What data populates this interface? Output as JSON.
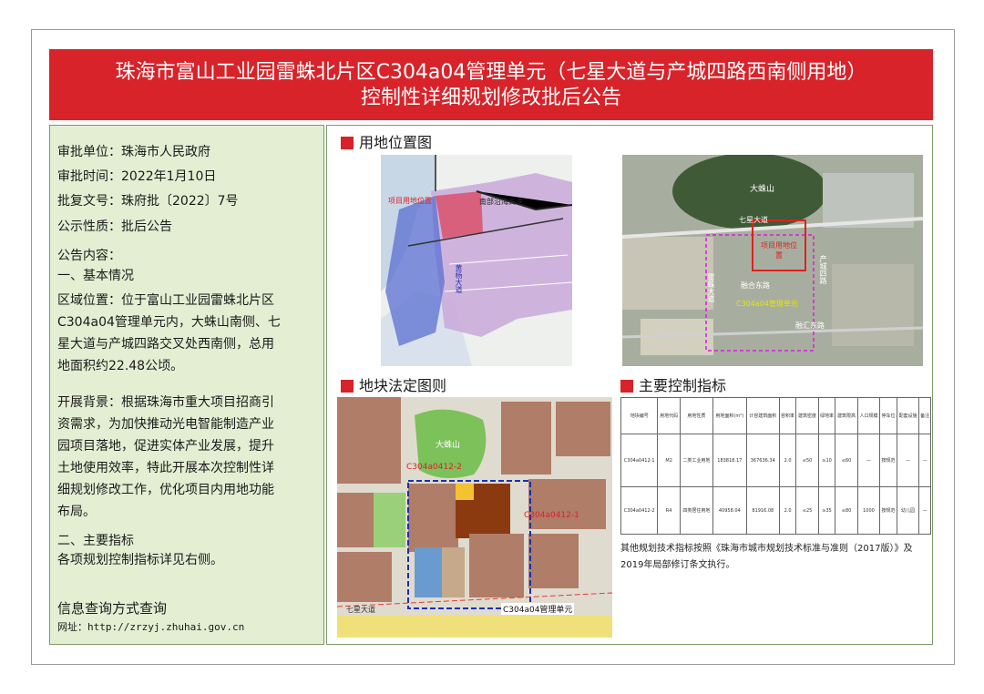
{
  "title": {
    "line1": "珠海市富山工业园雷蛛北片区C304a04管理单元（七星大道与产城四路西南侧用地）",
    "line2": "控制性详细规划修改批后公告"
  },
  "info": {
    "approval_unit": "审批单位：珠海市人民政府",
    "approval_time": "审批时间：2022年1月10日",
    "doc_no": "批复文号：珠府批〔2022〕7号",
    "nature": "公示性质：批后公告",
    "content_label": "公告内容：",
    "section1_title": "一、基本情况",
    "location_lines": [
      "区域位置：位于富山工业园雷蛛北片区",
      "C304a04管理单元内，大蛛山南侧、七",
      "星大道与产城四路交叉处西南侧，总用",
      "地面积约22.48公顷。"
    ],
    "background_lines": [
      "开展背景：根据珠海市重大项目招商引",
      "资需求，为加快推动光电智能制造产业",
      "园项目落地，促进实体产业发展，提升",
      "土地使用效率，特此开展本次控制性详",
      "细规划修改工作，优化项目内用地功能",
      "布局。"
    ],
    "section2_title": "二、主要指标",
    "section2_text": "各项规划控制指标详见右侧。",
    "query_title": "信息查询方式查询",
    "website": "网址：http://zrzyj.zhuhai.gov.cn"
  },
  "sections": {
    "location_map": "用地位置图",
    "statutory_map": "地块法定图则",
    "control_indicators": "主要控制指标"
  },
  "location_map_labels": {
    "project_site": "项目用地位置",
    "road_a": "南部沿海高速",
    "road_b": "黄杨大道"
  },
  "aerial_labels": {
    "mountain": "大蛛山",
    "road_qixing": "七星大道",
    "site": "项目用地位置",
    "unit": "C304a04管理单元",
    "road_rongsheng": "融合东路",
    "road_right": "产城四路",
    "road_left": "雷蛛大道",
    "road_bottom": "融汇东路"
  },
  "statutory_labels": {
    "mountain": "大蛛山",
    "parcel2": "C304a0412-2",
    "parcel1": "C304a0412-1",
    "unit": "C304a04管理单元",
    "road": "七星大道"
  },
  "table": {
    "headers": [
      "地块编号",
      "用地代码",
      "用地性质",
      "用地面积(m²)",
      "计容建筑面积",
      "容积率",
      "建筑密度",
      "绿地率",
      "建筑限高",
      "人口规模",
      "停车位",
      "配套设施",
      "备注"
    ],
    "rows": [
      [
        "C304a0412-1",
        "M2",
        "二类工业用地",
        "183818.17",
        "367636.34",
        "2.0",
        "≤50",
        "≥10",
        "≤60",
        "—",
        "按规范",
        "—",
        "—"
      ],
      [
        "C304a0412-2",
        "R4",
        "四类居住用地",
        "40958.04",
        "81916.08",
        "2.0",
        "≤25",
        "≥35",
        "≤80",
        "1000",
        "按规范",
        "幼儿园",
        "—"
      ]
    ]
  },
  "note": "其他规划技术指标按照《珠海市城市规划技术标准与准则（2017版）》及2019年局部修订条文执行。"
}
